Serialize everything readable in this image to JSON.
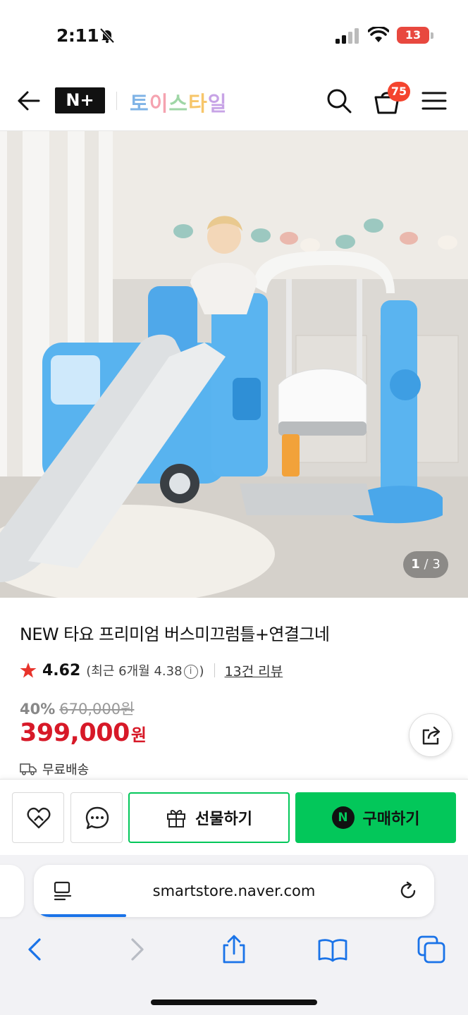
{
  "status_bar": {
    "time": "2:11",
    "battery": "13",
    "icons": [
      "bell-slash-icon",
      "cellular-signal-icon",
      "wifi-icon",
      "battery-icon"
    ]
  },
  "header": {
    "logo": "N+",
    "brand": "토이스타일",
    "brand_colors": [
      "#7fb3e6",
      "#f5a3b0",
      "#9fd6a6",
      "#f7c66a",
      "#c7a3e6"
    ],
    "cart_count": "75",
    "icons": [
      "back-arrow-icon",
      "search-icon",
      "cart-icon",
      "hamburger-menu-icon"
    ]
  },
  "product_image": {
    "counter_current": "1",
    "counter_total": "3"
  },
  "product": {
    "title": "NEW 타요 프리미엄 버스미끄럼틀+연결그네",
    "rating": "4.62",
    "recent_prefix": "(최근 6개월 4.38",
    "recent_suffix": ")",
    "info_glyph": "i",
    "review_link": "13건 리뷰",
    "discount_rate": "40%",
    "original_price": "670,000원",
    "price": "399,000",
    "price_unit": "원",
    "delivery": "무료배송"
  },
  "buy_bar": {
    "gift_label": "선물하기",
    "buy_label": "구매하기",
    "npay_glyph": "N",
    "accent_color": "#03c75a"
  },
  "browser": {
    "url": "smartstore.naver.com",
    "page_load_progress": 0.23,
    "toolbar_icons": [
      "back-icon",
      "forward-icon",
      "share-icon",
      "bookmarks-icon",
      "tabs-icon"
    ]
  },
  "colors": {
    "price_red": "#d71928",
    "badge_red": "#f4442e",
    "star_red": "#e8332b",
    "safari_blue": "#1a73e8"
  }
}
